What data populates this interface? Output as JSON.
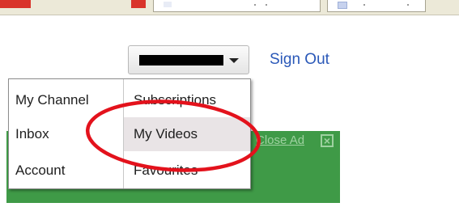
{
  "header": {
    "sign_out_label": "Sign Out"
  },
  "menu": {
    "items": [
      {
        "label": "My Channel"
      },
      {
        "label": "Inbox"
      },
      {
        "label": "Account"
      },
      {
        "label": "Subscriptions"
      },
      {
        "label": "My Videos"
      },
      {
        "label": "Favourites"
      }
    ]
  },
  "ad": {
    "close_label": "Close Ad",
    "close_x": "×"
  },
  "colors": {
    "ad_background": "#3f9a47",
    "link": "#2a58b8",
    "annotation": "#e3121c"
  },
  "icons": {
    "account_dropdown": "chevron-down-icon",
    "close_ad": "close-icon"
  }
}
